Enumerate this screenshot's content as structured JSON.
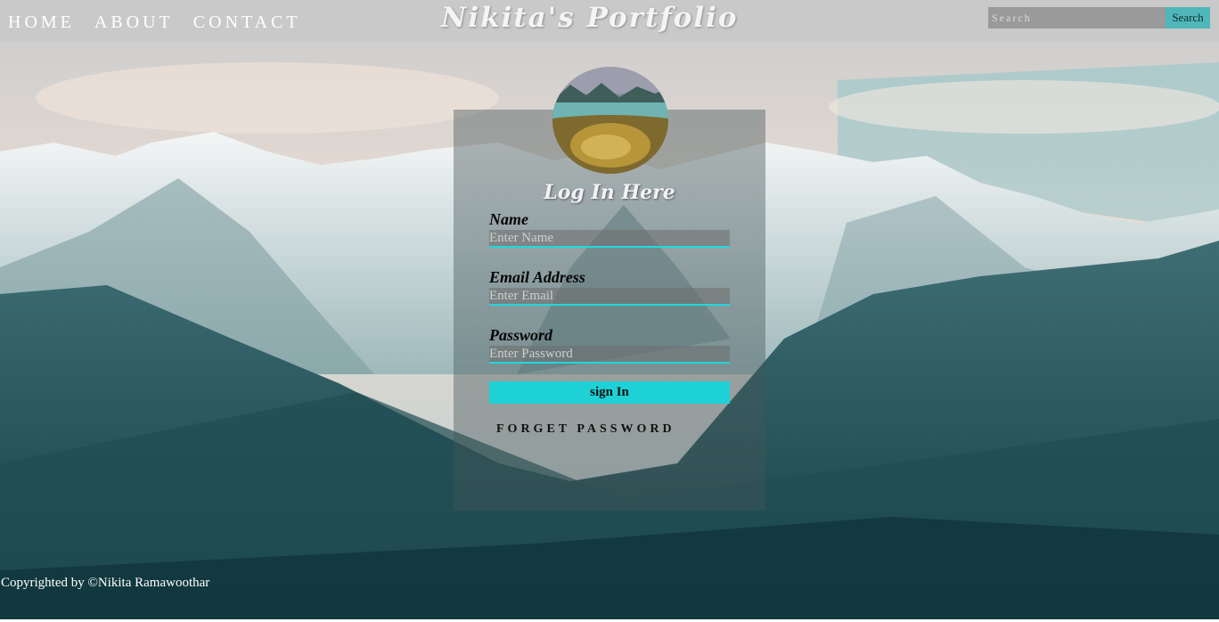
{
  "nav": {
    "items": [
      {
        "label": "HOME"
      },
      {
        "label": "ABOUT"
      },
      {
        "label": "CONTACT"
      }
    ]
  },
  "header": {
    "title": "Nikita's Portfolio"
  },
  "search": {
    "placeholder": "Search",
    "button_label": "Search"
  },
  "login": {
    "heading": "Log In Here",
    "name_label": "Name",
    "name_placeholder": "Enter Name",
    "email_label": "Email Address",
    "email_placeholder": "Enter Email",
    "password_label": "Password",
    "password_placeholder": "Enter Password",
    "signin_label": "sign In",
    "forget_label": "FORGET PASSWORD"
  },
  "footer": {
    "text": "Copyrighted by ©Nikita Ramawoothar"
  },
  "colors": {
    "accent": "#21d7de",
    "button": "#1ed1d6",
    "search_button": "#4fb6b9"
  },
  "icons": {
    "avatar": "mountain-lake-photo"
  }
}
